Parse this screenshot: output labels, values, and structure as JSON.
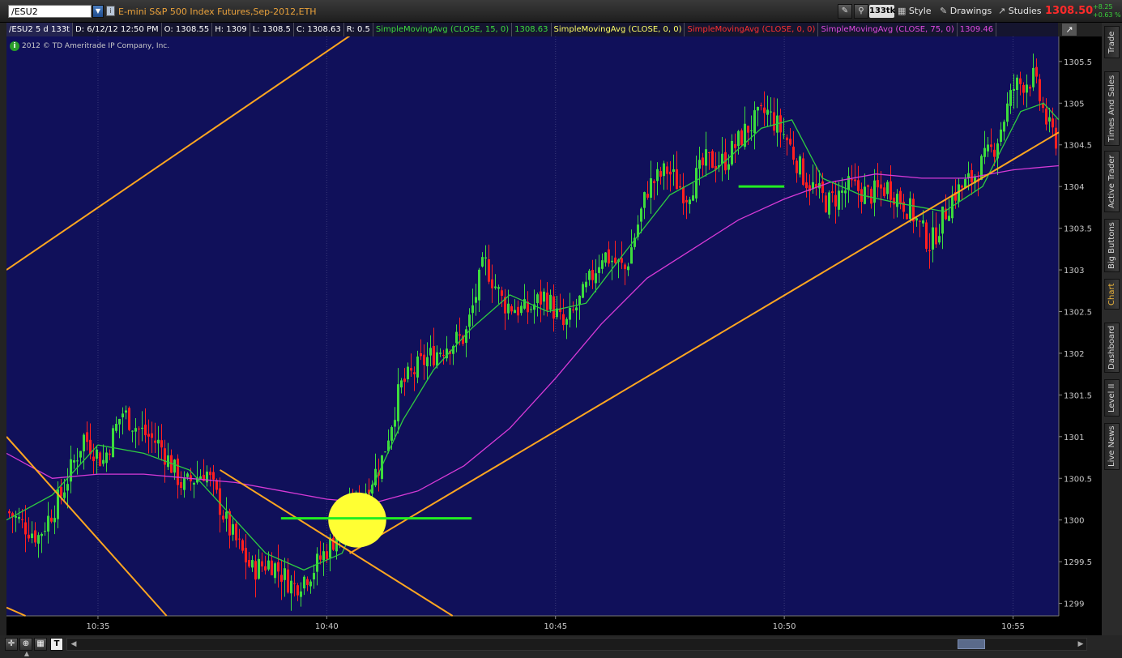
{
  "toolbar": {
    "symbol": "/ESU2",
    "description": "E-mini S&P 500 Index Futures,Sep-2012,ETH",
    "tick_badge": "133tk",
    "style_label": "Style",
    "drawings_label": "Drawings",
    "studies_label": "Studies",
    "last_price": "1308.50",
    "change_abs": "+8.25",
    "change_pct": "+0.63 %"
  },
  "infobar": {
    "symbol_period": "/ESU2 5 d 133t",
    "date": "D: 6/12/12 12:50 PM",
    "open": "O: 1308.55",
    "high": "H: 1309",
    "low": "L: 1308.5",
    "close": "C: 1308.63",
    "range": "R: 0.5",
    "sma15_label": "SimpleMovingAvg (CLOSE, 15, 0)",
    "sma15_value": "1308.63",
    "sma0a_label": "SimpleMovingAvg (CLOSE, 0, 0)",
    "sma0b_label": "SimpleMovingAvg (CLOSE, 0, 0)",
    "sma75_label": "SimpleMovingAvg (CLOSE, 75, 0)",
    "sma75_value": "1309.46"
  },
  "copyright": "2012 © TD Ameritrade IP Company, Inc.",
  "right_tabs": [
    "Trade",
    "Times And Sales",
    "Active Trader",
    "Big Buttons",
    "Chart",
    "Dashboard",
    "Level II",
    "Live News"
  ],
  "active_tab": "Chart",
  "colors": {
    "background": "#10105a",
    "up_bar": "#3ddc3d",
    "down_bar": "#ff2020",
    "sma15": "#2ecc40",
    "sma75": "#d63ad6",
    "trendline": "#ffa620",
    "highlight": "#ffff33",
    "level_line": "#22ee22"
  },
  "chart_data": {
    "type": "candlestick",
    "y_ticks": [
      "1305.5",
      "1305",
      "1304.5",
      "1304",
      "1303.5",
      "1303",
      "1302.5",
      "1302",
      "1301.5",
      "1301",
      "1300.5",
      "1300",
      "1299.5",
      "1299"
    ],
    "ylim": [
      1298.85,
      1305.8
    ],
    "x_ticks": [
      "10:35",
      "10:40",
      "10:45",
      "10:50",
      "10:55"
    ],
    "xlim": [
      "10:33",
      "10:56:00"
    ],
    "price_path": [
      [
        "10:33:00",
        1300.1
      ],
      [
        "10:33:40",
        1299.8
      ],
      [
        "10:34:10",
        1300.3
      ],
      [
        "10:34:40",
        1301.0
      ],
      [
        "10:35:05",
        1300.7
      ],
      [
        "10:35:30",
        1301.3
      ],
      [
        "10:35:50",
        1301.1
      ],
      [
        "10:36:20",
        1300.9
      ],
      [
        "10:36:50",
        1300.4
      ],
      [
        "10:37:20",
        1300.6
      ],
      [
        "10:37:50",
        1299.9
      ],
      [
        "10:38:20",
        1299.4
      ],
      [
        "10:38:45",
        1299.5
      ],
      [
        "10:39:15",
        1299.2
      ],
      [
        "10:39:40",
        1299.4
      ],
      [
        "10:40:10",
        1299.8
      ],
      [
        "10:40:40",
        1300.2
      ],
      [
        "10:41:10",
        1300.7
      ],
      [
        "10:41:35",
        1301.6
      ],
      [
        "10:42:05",
        1301.9
      ],
      [
        "10:42:35",
        1302.1
      ],
      [
        "10:43:00",
        1302.2
      ],
      [
        "10:43:25",
        1303.1
      ],
      [
        "10:43:50",
        1302.6
      ],
      [
        "10:44:20",
        1302.5
      ],
      [
        "10:44:45",
        1302.7
      ],
      [
        "10:45:10",
        1302.3
      ],
      [
        "10:45:35",
        1302.7
      ],
      [
        "10:46:00",
        1303.2
      ],
      [
        "10:46:30",
        1303.0
      ],
      [
        "10:47:00",
        1304.0
      ],
      [
        "10:47:25",
        1304.2
      ],
      [
        "10:47:50",
        1303.9
      ],
      [
        "10:48:15",
        1304.3
      ],
      [
        "10:48:40",
        1304.3
      ],
      [
        "10:49:10",
        1304.7
      ],
      [
        "10:49:35",
        1304.9
      ],
      [
        "10:50:00",
        1304.6
      ],
      [
        "10:50:25",
        1304.1
      ],
      [
        "10:50:55",
        1303.8
      ],
      [
        "10:51:25",
        1304.0
      ],
      [
        "10:51:50",
        1303.9
      ],
      [
        "10:52:15",
        1304.0
      ],
      [
        "10:52:45",
        1303.7
      ],
      [
        "10:53:10",
        1303.3
      ],
      [
        "10:53:40",
        1303.9
      ],
      [
        "10:54:05",
        1304.1
      ],
      [
        "10:54:35",
        1304.5
      ],
      [
        "10:55:00",
        1305.2
      ],
      [
        "10:55:25",
        1305.3
      ],
      [
        "10:55:45",
        1304.7
      ],
      [
        "10:56:00",
        1304.5
      ]
    ],
    "sma15": [
      [
        "10:33:00",
        1300.0
      ],
      [
        "10:34:00",
        1300.3
      ],
      [
        "10:35:00",
        1300.9
      ],
      [
        "10:36:00",
        1300.8
      ],
      [
        "10:37:00",
        1300.6
      ],
      [
        "10:37:50",
        1300.1
      ],
      [
        "10:38:40",
        1299.6
      ],
      [
        "10:39:30",
        1299.4
      ],
      [
        "10:40:20",
        1299.6
      ],
      [
        "10:41:00",
        1300.4
      ],
      [
        "10:41:40",
        1301.2
      ],
      [
        "10:42:20",
        1301.8
      ],
      [
        "10:43:10",
        1302.3
      ],
      [
        "10:44:00",
        1302.7
      ],
      [
        "10:44:50",
        1302.5
      ],
      [
        "10:45:40",
        1302.6
      ],
      [
        "10:46:30",
        1303.2
      ],
      [
        "10:47:30",
        1303.9
      ],
      [
        "10:48:30",
        1304.2
      ],
      [
        "10:49:30",
        1304.7
      ],
      [
        "10:50:10",
        1304.8
      ],
      [
        "10:50:50",
        1304.1
      ],
      [
        "10:51:40",
        1303.9
      ],
      [
        "10:52:30",
        1303.8
      ],
      [
        "10:53:30",
        1303.7
      ],
      [
        "10:54:20",
        1304.0
      ],
      [
        "10:55:10",
        1304.9
      ],
      [
        "10:55:40",
        1305.0
      ],
      [
        "10:56:00",
        1304.8
      ]
    ],
    "sma75": [
      [
        "10:33:00",
        1300.8
      ],
      [
        "10:34:00",
        1300.5
      ],
      [
        "10:35:00",
        1300.55
      ],
      [
        "10:36:00",
        1300.55
      ],
      [
        "10:37:00",
        1300.5
      ],
      [
        "10:38:00",
        1300.45
      ],
      [
        "10:39:00",
        1300.35
      ],
      [
        "10:40:00",
        1300.25
      ],
      [
        "10:41:00",
        1300.2
      ],
      [
        "10:42:00",
        1300.35
      ],
      [
        "10:43:00",
        1300.65
      ],
      [
        "10:44:00",
        1301.1
      ],
      [
        "10:45:00",
        1301.7
      ],
      [
        "10:46:00",
        1302.35
      ],
      [
        "10:47:00",
        1302.9
      ],
      [
        "10:48:00",
        1303.25
      ],
      [
        "10:49:00",
        1303.6
      ],
      [
        "10:50:00",
        1303.85
      ],
      [
        "10:51:00",
        1304.05
      ],
      [
        "10:52:00",
        1304.15
      ],
      [
        "10:53:00",
        1304.1
      ],
      [
        "10:54:00",
        1304.1
      ],
      [
        "10:55:00",
        1304.2
      ],
      [
        "10:56:00",
        1304.25
      ]
    ],
    "trendlines": [
      {
        "from": [
          "10:33:00",
          1303.0
        ],
        "to": [
          "10:40:45",
          1305.9
        ]
      },
      {
        "from": [
          "10:33:00",
          1301.0
        ],
        "to": [
          "10:36:30",
          1298.85
        ]
      },
      {
        "from": [
          "10:33:00",
          1298.95
        ],
        "to": [
          "10:33:25",
          1298.85
        ]
      },
      {
        "from": [
          "10:37:40",
          1300.6
        ],
        "to": [
          "10:42:45",
          1298.85
        ]
      },
      {
        "from": [
          "10:40:30",
          1299.6
        ],
        "to": [
          "10:56:00",
          1304.65
        ]
      }
    ],
    "support_lines": [
      {
        "from": [
          "10:39:00",
          1300.02
        ],
        "to": [
          "10:43:10",
          1300.02
        ]
      },
      {
        "from": [
          "10:49:00",
          1304.0
        ],
        "to": [
          "10:50:00",
          1304.0
        ]
      }
    ],
    "highlight_ellipse": {
      "center": [
        "10:40:40",
        1300.0
      ],
      "half_width_time_s": 38,
      "half_height_price": 0.33
    }
  }
}
